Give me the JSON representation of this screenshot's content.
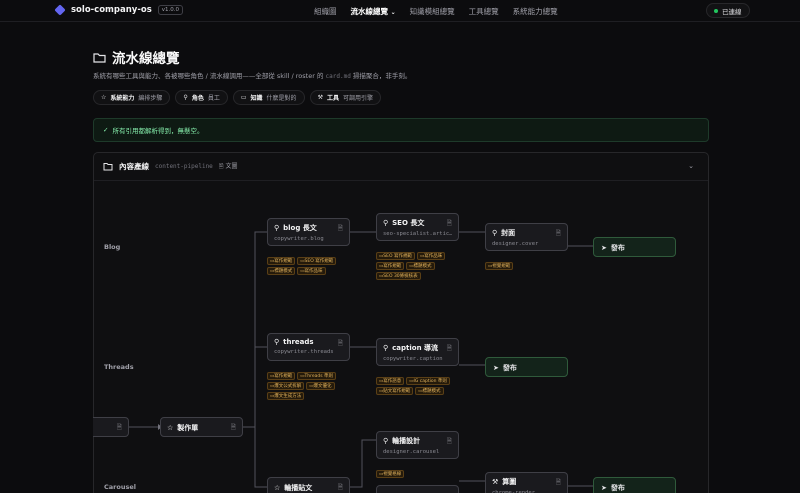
{
  "nav": {
    "brand": "solo-company-os",
    "version": "v1.0.0",
    "links": [
      "組織圖",
      "流水線總覽",
      "知識模組總覽",
      "工具總覽",
      "系統能力總覽"
    ],
    "active_index": 1,
    "status": "已連線"
  },
  "header": {
    "title": "流水線總覽",
    "subtitle_before": "系統有哪些工具與能力、各被哪些角色 / 流水線調用——全部從 skill / roster 的 ",
    "subtitle_code": "card.md",
    "subtitle_after": " 掃描聚合，非手刻。"
  },
  "chips": [
    {
      "label": "系統能力",
      "desc": "編排步驟",
      "icon": "star-icon"
    },
    {
      "label": "角色",
      "desc": "員工",
      "icon": "person-icon"
    },
    {
      "label": "知識",
      "desc": "什麼是對的",
      "icon": "book-icon"
    },
    {
      "label": "工具",
      "desc": "可調用引擎",
      "icon": "wrench-icon"
    }
  ],
  "alert": "所有引用都解析得到，無懸空。",
  "pipeline": {
    "title": "內容產線",
    "id": "content-pipeline",
    "doc_label": "文圖",
    "lanes": [
      "Blog",
      "Threads",
      "Carousel"
    ],
    "nodes": {
      "source": {
        "title": ""
      },
      "order": {
        "title": "製作單"
      },
      "blog": {
        "title": "blog 長文",
        "sub": "copywriter.blog"
      },
      "seo": {
        "title": "SEO 長文",
        "sub": "seo-specialist.artic…"
      },
      "cover": {
        "title": "封面",
        "sub": "designer.cover"
      },
      "publish_blog": {
        "title": "發布"
      },
      "threads": {
        "title": "threads",
        "sub": "copywriter.threads"
      },
      "caption": {
        "title": "caption 導流",
        "sub": "copywriter.caption"
      },
      "publish_threads": {
        "title": "發布"
      },
      "carousel_design": {
        "title": "輪播設計",
        "sub": "designer.carousel"
      },
      "carousel_post": {
        "title": "輪播貼文"
      },
      "render": {
        "title": "算圖",
        "sub": "chrome-render"
      },
      "publish_carousel": {
        "title": "發布"
      }
    },
    "tags": {
      "blog": [
        "寫作規範",
        "SEO 寫作規範",
        "標題模式",
        "寫作品味"
      ],
      "seo": [
        "SEO 寫作規範",
        "寫作品味",
        "寫作規範",
        "標題模式",
        "SEO 30條檢核表"
      ],
      "cover": [
        "視覺規範"
      ],
      "threads": [
        "寫作規範",
        "Threads 準則",
        "爆文公式拆解",
        "爆文優化",
        "爆文生成方法"
      ],
      "caption": [
        "寫作語意",
        "IG caption 準則",
        "貼文寫作規範",
        "標題模式"
      ],
      "carousel_design": [
        "視覺格線"
      ]
    }
  }
}
